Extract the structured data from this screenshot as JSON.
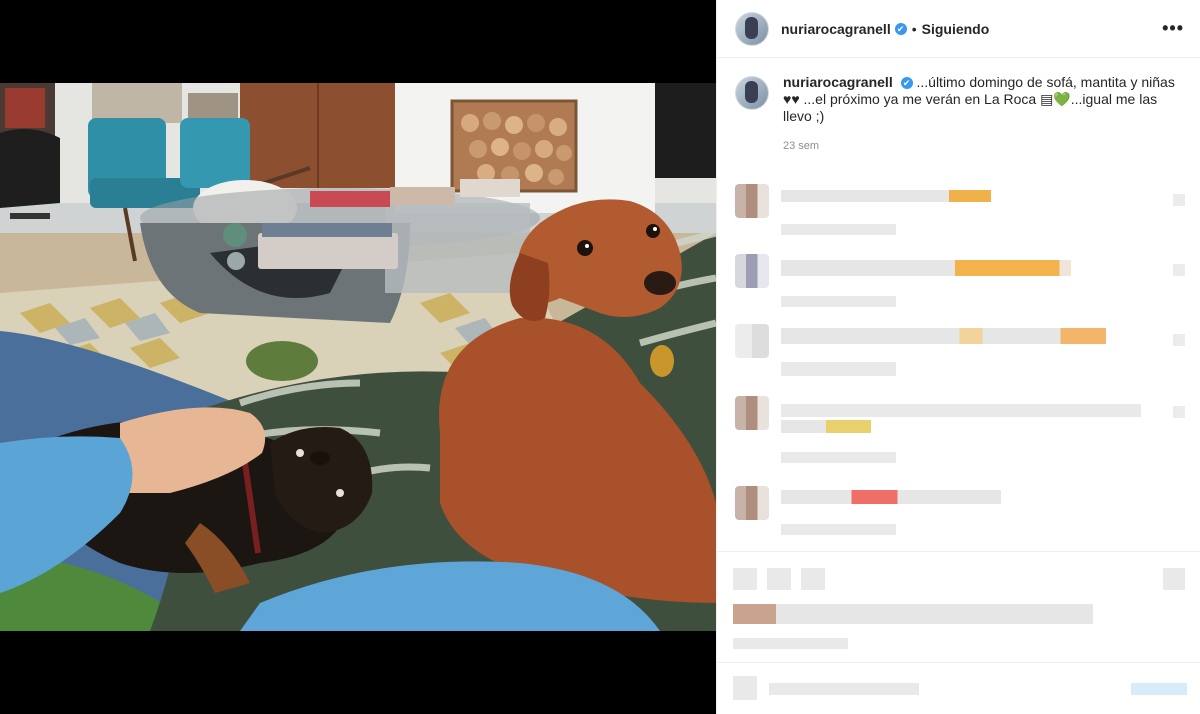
{
  "post": {
    "username": "nuriarocagranell",
    "verified_mark": "✔",
    "separator": "•",
    "follow_label": "Siguiendo",
    "more_label": "•••",
    "caption": "...último domingo de sofá, mantita y niñas ♥♥ ...el próximo ya me verán en La Roca ▤💚...igual me las llevo ;)",
    "timestamp": "23 sem"
  },
  "icons": {
    "verified": "verified-badge-icon",
    "more": "more-options-icon"
  },
  "colors": {
    "accent": "#3897f0",
    "follow_text": "#262626",
    "muted": "#8e8e8e",
    "media_bg": "#000000"
  }
}
